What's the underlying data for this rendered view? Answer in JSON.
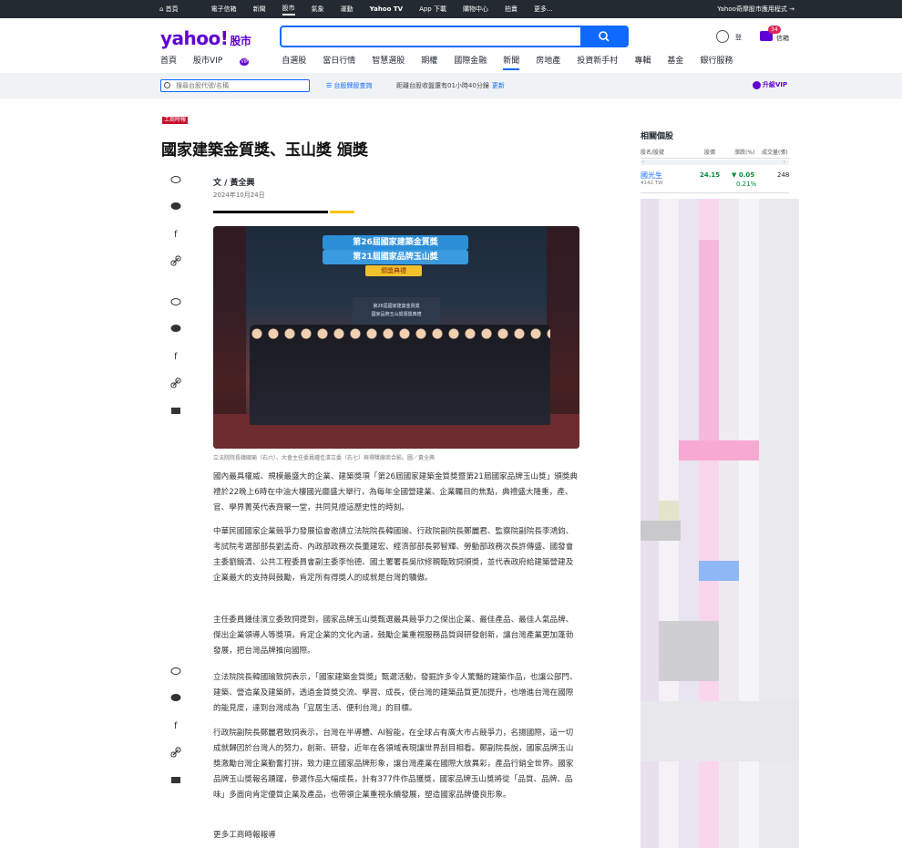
{
  "topbar": {
    "items": [
      "首頁",
      "電子信箱",
      "新聞",
      "股市",
      "氣象",
      "運動",
      "Yahoo TV",
      "App 下載",
      "購物中心",
      "拍賣",
      "更多..."
    ],
    "right": "Yahoo奇摩股市應用程式 →"
  },
  "header": {
    "logo": "yahoo!",
    "logo_sub": "股市",
    "login": "登",
    "mail_label": "信箱",
    "mail_count": "34"
  },
  "nav": {
    "items": [
      "首頁",
      "股市VIP",
      "自選股",
      "當日行情",
      "智慧選股",
      "期權",
      "國際金融",
      "新聞",
      "房地產",
      "投資新手村",
      "專輯",
      "基金",
      "銀行服務"
    ],
    "vip_badge": "VIP"
  },
  "subbar": {
    "search_placeholder": "搜尋台股代號/名稱",
    "cards_link": "台股牌股查詢",
    "market_msg": "距離台股收盤還有01小時40分鐘",
    "update": "更新",
    "upgrade": "升級VIP"
  },
  "article": {
    "source": "工商時報",
    "title": "國家建築金質獎、玉山獎 頒獎",
    "author": "文 / 黃全興",
    "date": "2024年10月24日",
    "photo_banner1": "第26屆國家建築金質獎",
    "photo_banner2": "第21屆國家品牌玉山獎",
    "photo_banner3": "頒獎典禮",
    "photo_screen_line1": "第26屆國家建築金質獎",
    "photo_screen_line2": "國家品牌玉山獎頒獎典禮",
    "caption": "立法院院長韓國瑜（右六）、大會主任委員鍾佳濱立委（右七）與得獎廠商合影。圖／黃全興",
    "paragraphs": [
      "國內最具權威、規模最盛大的企業、建築獎項「第26屆國家建築金質獎暨第21屆國家品牌玉山獎」頒獎典禮於22晚上6時在中油大樓國光廳盛大舉行，為每年全國營建業、企業矚目的焦點，典禮盛大隆重，產、官、學界菁英代表齊聚一堂，共同見證這歷史性的時刻。",
      "中華民國國家企業競爭力發展協會邀請立法院院長韓國瑜、行政院副院長鄭麗君、監察院副院長李鴻鈞、考試院考選部部長劉孟奇、內政部政務次長董建宏、經濟部部長郭智輝、勞動部政務次長許傳盛、國發會主委劉鏡清、公共工程委員會副主委李怡德、國土署署長吳欣修親臨致詞頒獎，並代表政府給建築營建及企業最大的支持與鼓勵，肯定所有得獎人的成就是台灣的驕傲。",
      "主任委員鍾佳濱立委致詞提到，國家品牌玉山獎甄選最具競爭力之傑出企業、最佳產品、最佳人氣品牌、傑出企業領導人等獎項，肯定企業的文化內涵，鼓勵企業重視服務品質與研發創新，讓台灣產業更加蓬勃發展，把台灣品牌推向國際。",
      "立法院院長韓國瑜致詞表示，「國家建築金質獎」甄選活動，發掘許多令人驚豔的建築作品，也讓公部門、建築、營造業及建築師，透過金質獎交流、學習、成長，使台灣的建築品質更加提升，也增進台灣在國際的能見度，達到台灣成為「宜居生活、便利台灣」的目標。",
      "行政院副院長鄭麗君致詞表示，台灣在半導體、AI智能，在全球占有廣大市占競爭力，名揚國際，這一切成就歸因於台灣人的努力，創新、研發，近年在各領域表現讓世界刮目相看。鄭副院長說，國家品牌玉山獎激勵台灣企業勤奮打拼，致力建立國家品牌形象，讓台灣產業在國際大放異彩，產品行銷全世界。國家品牌玉山獎報名踴躍，參選作品大幅成長，計有377件作品獲獎，國家品牌玉山獎將從「品質、品牌、品味」多面向肯定優質企業及產品，也帶領企業重視永續發展，塑造國家品牌優良形象。",
      "更多工商時報報導"
    ]
  },
  "related": {
    "title": "相關個股",
    "headers": [
      "股名/股號",
      "股價",
      "漲跌(%)",
      "成交量(張)"
    ],
    "stock": {
      "name": "國光生",
      "code": "4142.TW",
      "price": "24.15",
      "change": "0.05",
      "pct": "0.21%",
      "volume": "248"
    }
  },
  "colors": {
    "brand": "#6001d2",
    "accent": "#0f69ff",
    "up": "#008c3c"
  }
}
